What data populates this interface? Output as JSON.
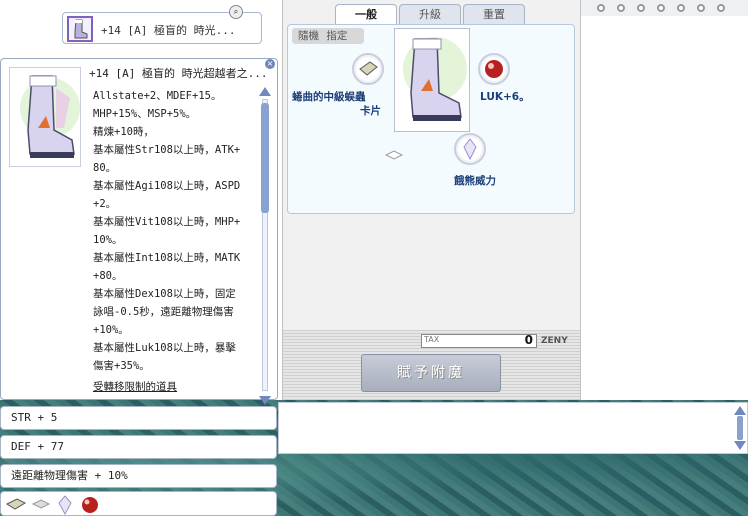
{
  "mini_box": {
    "title": "+14 [A] 極盲的 時光..."
  },
  "description": {
    "title": "+14 [A] 極盲的 時光超越者之...",
    "lines": [
      "Allstate+2、MDEF+15。",
      "MHP+15%、MSP+5%。",
      "精煉+10時，",
      "基本屬性Str108以上時，ATK+",
      "80。",
      "基本屬性Agi108以上時，ASPD",
      "+2。",
      "基本屬性Vit108以上時，MHP+",
      "10%。",
      "基本屬性Int108以上時，MATK",
      "+80。",
      "基本屬性Dex108以上時，固定",
      "詠唱-0.5秒，遠距離物理傷害",
      "+10%。",
      "基本屬性Luk108以上時，暴擊",
      "傷害+35%。"
    ],
    "footer": "受轉移限制的道具"
  },
  "enchant": {
    "tabs": [
      "一般",
      "升級",
      "重置"
    ],
    "mode_pill": "隨機 指定",
    "slot_left_label_1": "蜷曲的中級蜈蟲",
    "slot_left_label_2": "卡片",
    "slot_right_label": "LUK+6。",
    "slot_bottom_label": "餓熊威力",
    "tax_label": "TAX",
    "tax_amount": "0",
    "zeny_label": "ZENY",
    "button_label": "賦予附魔"
  },
  "options": [
    "STR + 5",
    "DEF + 77",
    "遠距離物理傷害 + 10%"
  ],
  "colors": {
    "accent_blue": "#7088c0",
    "label_blue": "#1c3e78",
    "card_red": "#b82020"
  }
}
